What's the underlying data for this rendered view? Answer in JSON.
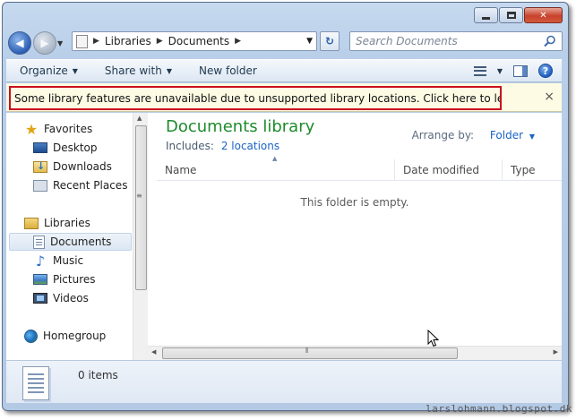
{
  "address": {
    "crumbs": [
      "Libraries",
      "Documents"
    ]
  },
  "search": {
    "placeholder": "Search Documents"
  },
  "toolbar": {
    "organize": "Organize",
    "share_with": "Share with",
    "new_folder": "New folder"
  },
  "infobar": {
    "message": "Some library features are unavailable due to unsupported library locations. Click here to learn more...",
    "close": "×"
  },
  "nav": {
    "favorites": "Favorites",
    "desktop": "Desktop",
    "downloads": "Downloads",
    "recent_places": "Recent Places",
    "libraries": "Libraries",
    "documents": "Documents",
    "music": "Music",
    "pictures": "Pictures",
    "videos": "Videos",
    "homegroup": "Homegroup"
  },
  "main": {
    "title": "Documents library",
    "includes_label": "Includes:",
    "includes_link": "2 locations",
    "arrange_label": "Arrange by:",
    "arrange_value": "Folder",
    "columns": [
      "Name",
      "Date modified",
      "Type"
    ],
    "empty_text": "This folder is empty."
  },
  "details": {
    "count": "0 items"
  },
  "watermark": "larslohmann.blogspot.dk",
  "colors": {
    "title_green": "#1e8b2b",
    "link_blue": "#1a64c7",
    "infobar_border": "#c8101f"
  }
}
